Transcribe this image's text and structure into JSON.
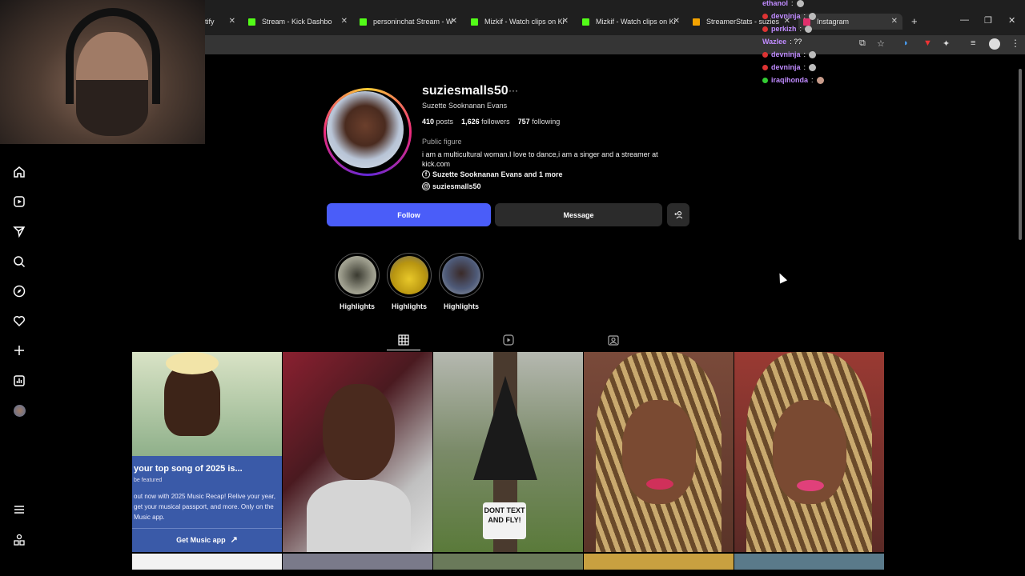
{
  "browser": {
    "tabs": [
      {
        "title": "tify",
        "favicon_color": "#1db954"
      },
      {
        "title": "Stream - Kick Dashbo",
        "favicon_color": "#53fc18"
      },
      {
        "title": "personinchat Stream - W",
        "favicon_color": "#53fc18"
      },
      {
        "title": "Mizkif - Watch clips on Ki",
        "favicon_color": "#53fc18"
      },
      {
        "title": "Mizkif - Watch clips on Ki",
        "favicon_color": "#53fc18"
      },
      {
        "title": "StreamerStats - suzies",
        "favicon_color": "#f4a300"
      },
      {
        "title": "Instagram",
        "favicon_color": "#e1306c"
      }
    ],
    "new_tab": "+",
    "minimize": "—",
    "maximize": "❐",
    "close": "✕"
  },
  "chat": [
    {
      "user": "ethanol",
      "msg": ":",
      "badge": "none",
      "emote": true
    },
    {
      "user": "devninja",
      "msg": ":",
      "badge": "red",
      "emote": true
    },
    {
      "user": "perkizh",
      "msg": ":",
      "badge": "red",
      "emote": true
    },
    {
      "user": "Wazlee",
      "msg": ": ??",
      "badge": "none",
      "emote": false
    },
    {
      "user": "devninja",
      "msg": ":",
      "badge": "red",
      "emote": true
    },
    {
      "user": "devninja",
      "msg": ":",
      "badge": "red",
      "emote": true
    },
    {
      "user": "iraqihonda",
      "msg": ":",
      "badge": "green",
      "emote": true
    }
  ],
  "profile": {
    "username": "suziesmalls50",
    "more": "···",
    "full_name": "Suzette Sooknanan Evans",
    "posts_count": "410",
    "posts_label": "posts",
    "followers_count": "1,626",
    "followers_label": "followers",
    "following_count": "757",
    "following_label": "following",
    "category": "Public figure",
    "bio": "i am a multicultural woman.I love to dance,i am a singer and a streamer at kick.com",
    "link_facebook": "Suzette Sooknanan Evans and 1 more",
    "link_threads": "suziesmalls50",
    "follow_label": "Follow",
    "message_label": "Message"
  },
  "highlights": [
    {
      "label": "Highlights",
      "color": "#8b8b7a"
    },
    {
      "label": "Highlights",
      "color": "#c9a825"
    },
    {
      "label": "Highlights",
      "color": "#4e5a78"
    }
  ],
  "posts": [
    {
      "kind": "recap",
      "title": "your top song of 2025 is...",
      "sub": "be featured",
      "body": "out now with 2025 Music Recap! Relive your year, get your musical passport, and more. Only on the Music app.",
      "cta": "Get Music app",
      "bg": "#3a5aa8"
    },
    {
      "kind": "photo",
      "bg": "#6b2b35"
    },
    {
      "kind": "photo",
      "bg": "#4d5a3a",
      "sign": "DONT TEXT AND FLY!"
    },
    {
      "kind": "photo",
      "bg": "#5a3a2a"
    },
    {
      "kind": "photo",
      "bg": "#6a3a33"
    }
  ]
}
